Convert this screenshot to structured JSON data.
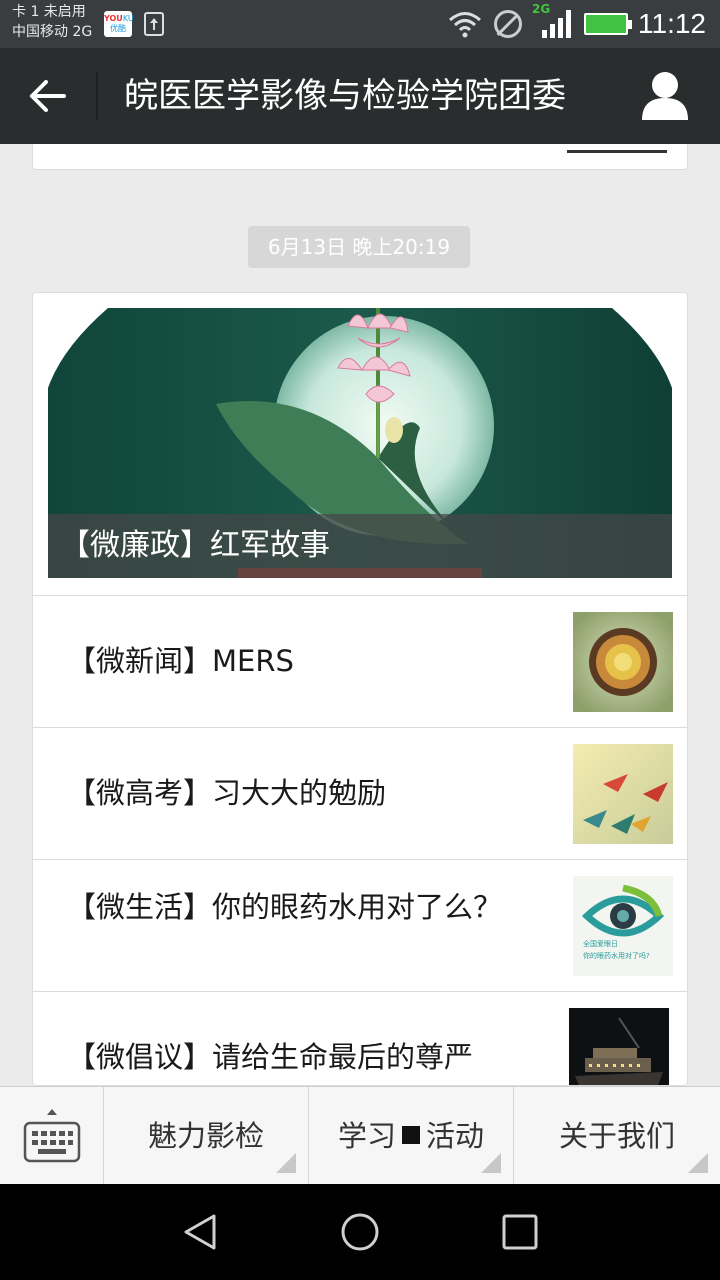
{
  "status_bar": {
    "carrier_line1": "卡 1 未启用",
    "carrier_line2": "中国移动 2G",
    "network_type": "2G",
    "time": "11:12"
  },
  "header": {
    "title": "皖医医学影像与检验学院团委"
  },
  "timestamp": "6月13日 晚上20:19",
  "article": {
    "cover_title": "【微廉政】红军故事",
    "items": [
      {
        "title": "【微新闻】MERS"
      },
      {
        "title": "【微高考】习大大的勉励"
      },
      {
        "title": "【微生活】你的眼药水用对了么？"
      },
      {
        "title": "【微倡议】请给生命最后的尊严"
      }
    ],
    "eye_thumb_text_1": "全国爱眼日",
    "eye_thumb_text_2": "你的眼药水用对了吗?"
  },
  "menu": {
    "items": [
      {
        "label": "魅力影检"
      },
      {
        "label_left": "学习",
        "label_right": "活动"
      },
      {
        "label": "关于我们"
      }
    ]
  },
  "colors": {
    "title_bar": "#292d2e",
    "status_bar": "#3a3d3f",
    "background": "#ebebeb",
    "battery_green": "#41c341"
  }
}
